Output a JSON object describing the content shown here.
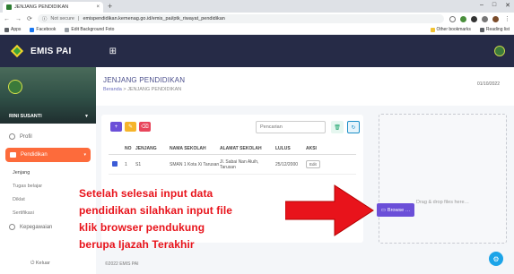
{
  "browser": {
    "tab_title": "JENJANG PENDIDIKAN",
    "tab_close": "×",
    "new_tab": "+",
    "window_controls": [
      "–",
      "□",
      "✕"
    ],
    "security": "Not secure",
    "url": "emispendidikan.kemenag.go.id/emis_pai/ptk_riwayat_pendidikan",
    "bookmarks": [
      "Apps",
      "Facebook",
      "Edit Background Foto"
    ],
    "other_bookmarks": "Other bookmarks",
    "reading_list": "Reading list"
  },
  "app": {
    "brand": "EMIS PAI",
    "menu_icon": "grid-icon"
  },
  "sidebar": {
    "user_name": "RINI SUSANTI",
    "items": [
      {
        "label": "Profil",
        "icon": "user-icon"
      },
      {
        "label": "Pendidikan",
        "icon": "folder-icon"
      },
      {
        "label": "Kepegawaian",
        "icon": "group-icon"
      }
    ],
    "sub_items": [
      "Jenjang",
      "Tugas belajar",
      "Diklat",
      "Sertifikasi"
    ],
    "logout": "Keluar"
  },
  "page": {
    "title": "JENJANG PENDIDIKAN",
    "breadcrumb_home": "Beranda",
    "breadcrumb_sep": ">",
    "breadcrumb_current": "JENJANG PENDIDIKAN",
    "date": "01/10/2022"
  },
  "toolbar": {
    "add_icon": "+",
    "edit_icon": "✎",
    "delete_icon": "⌫",
    "search_placeholder": "Pencarian",
    "trash_icon": "🗑",
    "refresh_icon": "↻"
  },
  "table": {
    "headers": [
      "",
      "NO",
      "JENJANG",
      "NAMA SEKOLAH",
      "ALAMAT SEKOLAH",
      "LULUS",
      "AKSI"
    ],
    "rows": [
      {
        "no": "1",
        "jenjang": "S1",
        "nama_sekolah": "SMAN 1 Kota Xi Tarusan",
        "alamat": "Jl. Sabai Nan Aluih, Tarusan",
        "lulus": "25/12/2000",
        "aksi": "Edit"
      }
    ]
  },
  "upload": {
    "dropzone_text": "Drag & drop files here…",
    "browse_label": "Browse …"
  },
  "footer": "©2022 EMIS PAI",
  "annotation": {
    "lines": [
      "Setelah selesai input data",
      "pendidikan silahkan input file",
      "klik browser pendukung",
      "berupa Ijazah Terakhir"
    ],
    "color": "#e8131b"
  }
}
